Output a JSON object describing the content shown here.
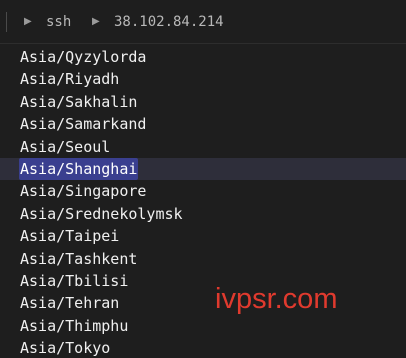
{
  "tabbar": {
    "items": [
      {
        "label": "ssh"
      },
      {
        "label": "38.102.84.214"
      }
    ],
    "arrow_icon": "triangle-right-icon"
  },
  "terminal": {
    "lines": [
      "Asia/Qyzylorda",
      "Asia/Riyadh",
      "Asia/Sakhalin",
      "Asia/Samarkand",
      "Asia/Seoul",
      "Asia/Shanghai",
      "Asia/Singapore",
      "Asia/Srednekolymsk",
      "Asia/Taipei",
      "Asia/Tashkent",
      "Asia/Tbilisi",
      "Asia/Tehran",
      "Asia/Thimphu",
      "Asia/Tokyo"
    ],
    "selected_line": "Asia/Shanghai"
  },
  "watermark": {
    "text": "ivpsr.com",
    "color": "#e03a2e"
  },
  "colors": {
    "background": "#1e1e1e",
    "selection": "#3a3f8f",
    "text": "#f0f0f0"
  }
}
